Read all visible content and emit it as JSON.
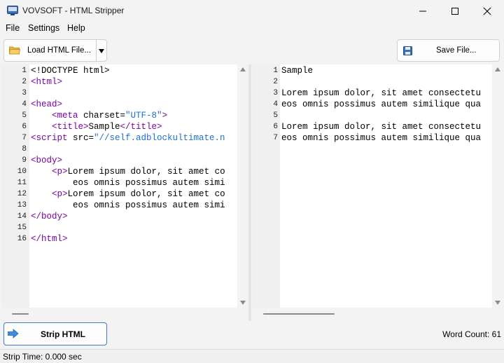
{
  "window": {
    "title": "VOVSOFT - HTML Stripper"
  },
  "menu": [
    "File",
    "Settings",
    "Help"
  ],
  "toolbar": {
    "load_label": "Load HTML File...",
    "save_label": "Save File..."
  },
  "left_editor": {
    "lines": [
      {
        "n": "1",
        "parts": [
          [
            "plain",
            "<!DOCTYPE html>"
          ]
        ]
      },
      {
        "n": "2",
        "parts": [
          [
            "tag",
            "<html>"
          ]
        ]
      },
      {
        "n": "3",
        "parts": []
      },
      {
        "n": "4",
        "parts": [
          [
            "tag",
            "<head>"
          ]
        ]
      },
      {
        "n": "5",
        "parts": [
          [
            "plain",
            "    "
          ],
          [
            "tag",
            "<meta"
          ],
          [
            "attr",
            " charset="
          ],
          [
            "val",
            "\"UTF-8\""
          ],
          [
            "tag",
            ">"
          ]
        ]
      },
      {
        "n": "6",
        "parts": [
          [
            "plain",
            "    "
          ],
          [
            "tag",
            "<title>"
          ],
          [
            "plain",
            "Sample"
          ],
          [
            "tag",
            "</title>"
          ]
        ]
      },
      {
        "n": "7",
        "parts": [
          [
            "tag",
            "<script"
          ],
          [
            "attr",
            " src="
          ],
          [
            "val",
            "\"//self.adblockultimate.n"
          ]
        ]
      },
      {
        "n": "8",
        "parts": []
      },
      {
        "n": "9",
        "parts": [
          [
            "tag",
            "<body>"
          ]
        ]
      },
      {
        "n": "10",
        "parts": [
          [
            "plain",
            "    "
          ],
          [
            "tag",
            "<p>"
          ],
          [
            "plain",
            "Lorem ipsum dolor, sit amet co"
          ]
        ]
      },
      {
        "n": "11",
        "parts": [
          [
            "plain",
            "        eos omnis possimus autem simi"
          ]
        ]
      },
      {
        "n": "12",
        "parts": [
          [
            "plain",
            "    "
          ],
          [
            "tag",
            "<p>"
          ],
          [
            "plain",
            "Lorem ipsum dolor, sit amet co"
          ]
        ]
      },
      {
        "n": "13",
        "parts": [
          [
            "plain",
            "        eos omnis possimus autem simi"
          ]
        ]
      },
      {
        "n": "14",
        "parts": [
          [
            "tag",
            "</body>"
          ]
        ]
      },
      {
        "n": "15",
        "parts": []
      },
      {
        "n": "16",
        "parts": [
          [
            "tag",
            "</html>"
          ]
        ]
      }
    ]
  },
  "right_editor": {
    "lines": [
      {
        "n": "1",
        "text": "Sample"
      },
      {
        "n": "2",
        "text": ""
      },
      {
        "n": "3",
        "text": "Lorem ipsum dolor, sit amet consectetu"
      },
      {
        "n": "4",
        "text": "eos omnis possimus autem similique qua"
      },
      {
        "n": "5",
        "text": ""
      },
      {
        "n": "6",
        "text": "Lorem ipsum dolor, sit amet consectetu"
      },
      {
        "n": "7",
        "text": "eos omnis possimus autem similique qua"
      }
    ]
  },
  "bottom": {
    "strip_label": "Strip HTML",
    "word_count": "Word Count: 61"
  },
  "status": {
    "text": "Strip Time: 0.000 sec"
  },
  "icons": {
    "app": "app-icon",
    "folder": "folder-icon",
    "save": "floppy-disk-icon",
    "strip": "arrow-right-icon"
  },
  "colors": {
    "tag": "#7b00a8",
    "value": "#1d6fd4",
    "accent": "#3a7bd5"
  }
}
